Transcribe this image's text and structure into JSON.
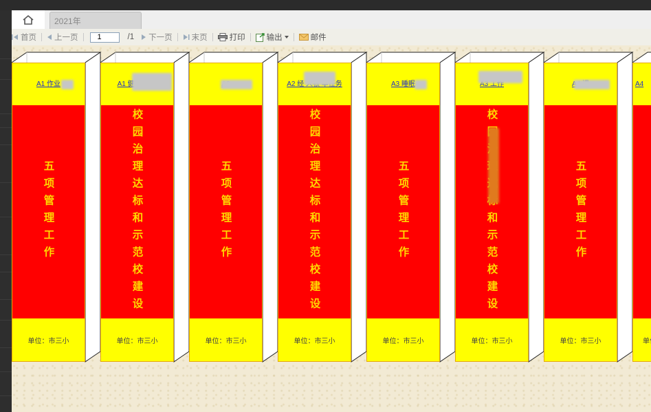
{
  "tabs": {
    "home_icon": "home-icon",
    "year_tab": "2021年"
  },
  "toolbar": {
    "first": "首页",
    "prev": "上一页",
    "page_value": "1",
    "total": "/1",
    "next": "下一页",
    "last": "末页",
    "print": "打印",
    "export": "输出",
    "mail": "邮件"
  },
  "binders": [
    {
      "label": "A1 作业",
      "title": "五项管理工作",
      "unit": "单位：市三小"
    },
    {
      "label": "A1 健全  领导",
      "title": "校园治理达标和示范校建设",
      "unit": "单位：市三小"
    },
    {
      "label": "A2",
      "title": "五项管理工作",
      "unit": "单位：市三小"
    },
    {
      "label": "A2 经  人根  本任务",
      "title": "校园治理达标和示范校建设",
      "unit": "单位：市三小"
    },
    {
      "label": "A3 睡眠",
      "title": "五项管理工作",
      "unit": "单位：市三小"
    },
    {
      "label": "A3  工作",
      "title": "校园治理达标和示范校建设",
      "unit": "单位：市三小"
    },
    {
      "label": "A4 课",
      "title": "五项管理工作",
      "unit": "单位：市三小"
    },
    {
      "label": "A4",
      "title": "",
      "unit": "单位：市三小"
    }
  ]
}
